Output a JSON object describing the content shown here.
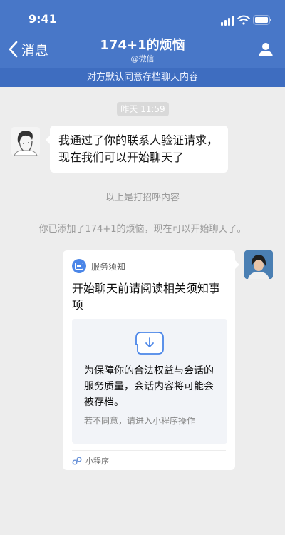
{
  "status_bar": {
    "time": "9:41"
  },
  "header": {
    "back_label": "消息",
    "title": "174+1的烦恼",
    "subtitle": "@微信",
    "banner": "对方默认同意存档聊天内容"
  },
  "chat": {
    "timestamp": "昨天 11:59",
    "incoming_message": "我通过了你的联系人验证请求，现在我们可以开始聊天了",
    "system_notice_1": "以上是打招呼内容",
    "system_notice_2": "你已添加了174+1的烦恼，现在可以开始聊天了。"
  },
  "card": {
    "service_label": "服务须知",
    "title": "开始聊天前请阅读相关须知事项",
    "box_main": "为保障你的合法权益与会话的服务质量，会话内容将可能会被存档。",
    "box_sub": "若不同意，请进入小程序操作",
    "footer_label": "小程序"
  },
  "colors": {
    "header_bg": "#4877c8",
    "banner_bg": "#3e6dc0",
    "chat_bg": "#ededed",
    "accent": "#4b86e8"
  }
}
